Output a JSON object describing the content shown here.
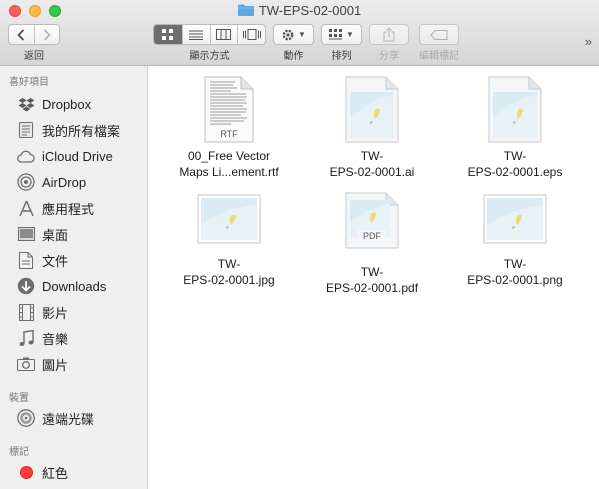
{
  "window": {
    "title": "TW-EPS-02-0001"
  },
  "toolbar": {
    "back_label": "返回",
    "view_label": "顯示方式",
    "action_label": "動作",
    "arrange_label": "排列",
    "share_label": "分享",
    "tags_label": "編輯標記",
    "more_label": "»"
  },
  "sidebar": {
    "favorites_header": "喜好項目",
    "favorites": [
      {
        "label": "Dropbox",
        "icon": "dropbox-icon"
      },
      {
        "label": "我的所有檔案",
        "icon": "all-files-icon"
      },
      {
        "label": "iCloud Drive",
        "icon": "cloud-icon"
      },
      {
        "label": "AirDrop",
        "icon": "airdrop-icon"
      },
      {
        "label": "應用程式",
        "icon": "applications-icon"
      },
      {
        "label": "桌面",
        "icon": "desktop-icon"
      },
      {
        "label": "文件",
        "icon": "documents-icon"
      },
      {
        "label": "Downloads",
        "icon": "downloads-icon"
      },
      {
        "label": "影片",
        "icon": "movies-icon"
      },
      {
        "label": "音樂",
        "icon": "music-icon"
      },
      {
        "label": "圖片",
        "icon": "pictures-icon"
      }
    ],
    "devices_header": "裝置",
    "devices": [
      {
        "label": "遠端光碟",
        "icon": "remote-disc-icon"
      }
    ],
    "tags_header": "標記",
    "tags": [
      {
        "label": "紅色",
        "color": "#fc3d39"
      }
    ]
  },
  "files": [
    {
      "line1": "00_Free Vector",
      "line2": "Maps Li...ement.rtf",
      "kind": "rtf",
      "badge": "RTF"
    },
    {
      "line1": "TW-",
      "line2": "EPS-02-0001.ai",
      "kind": "ai"
    },
    {
      "line1": "TW-",
      "line2": "EPS-02-0001.eps",
      "kind": "eps"
    },
    {
      "line1": "TW-",
      "line2": "EPS-02-0001.jpg",
      "kind": "jpg"
    },
    {
      "line1": "TW-",
      "line2": "EPS-02-0001.pdf",
      "kind": "pdf",
      "badge": "PDF"
    },
    {
      "line1": "TW-",
      "line2": "EPS-02-0001.png",
      "kind": "png"
    }
  ],
  "colors": {
    "folder": "#5aa9e6",
    "tag_red": "#fc3d39",
    "active_view": "#6d6d6d"
  }
}
